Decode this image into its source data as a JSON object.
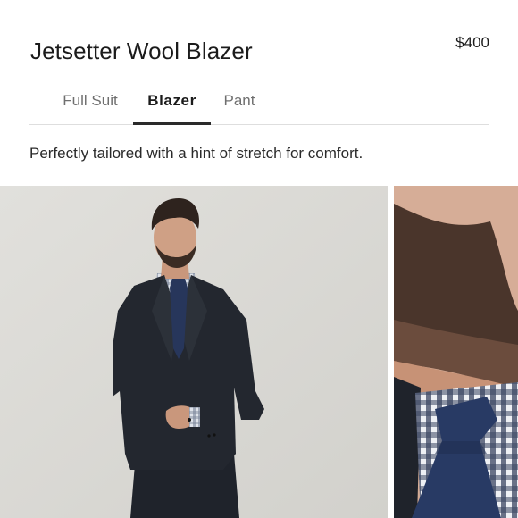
{
  "product": {
    "title": "Jetsetter Wool Blazer",
    "price": "$400",
    "description": "Perfectly tailored with a hint of stretch for comfort."
  },
  "tabs": [
    {
      "label": "Full Suit",
      "selected": false
    },
    {
      "label": "Blazer",
      "selected": true
    },
    {
      "label": "Pant",
      "selected": false
    }
  ],
  "gallery": {
    "images": [
      {
        "name": "model-full-blazer-photo"
      },
      {
        "name": "closeup-beard-tie-photo"
      }
    ]
  },
  "colors": {
    "text": "#1b1b1b",
    "muted_tab": "#6f6f6f",
    "divider": "#dedede",
    "blazer": "#22262e",
    "tie": "#27365b"
  }
}
